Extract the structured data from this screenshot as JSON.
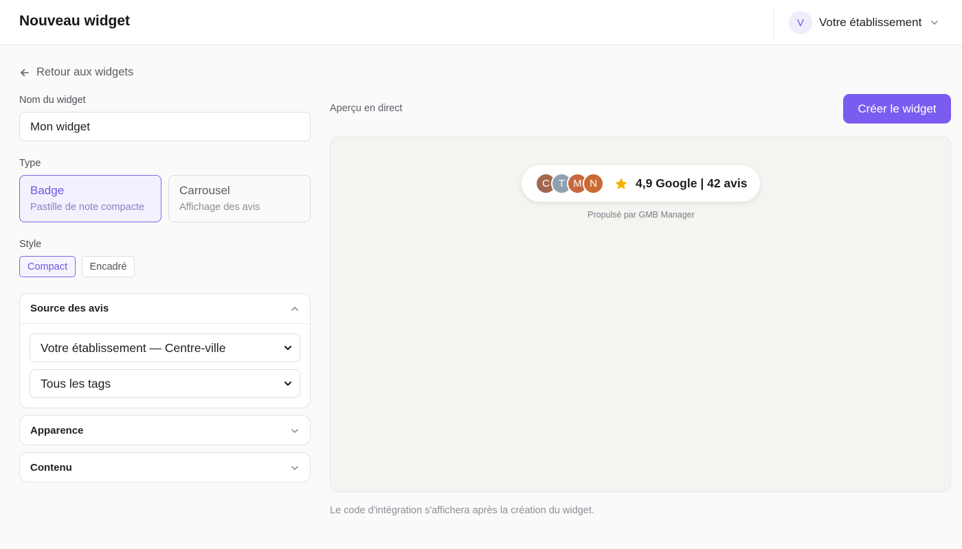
{
  "header": {
    "title": "Nouveau widget",
    "business": {
      "avatar_letter": "V",
      "name": "Votre établissement"
    }
  },
  "back_link": "Retour aux widgets",
  "form": {
    "name": {
      "label": "Nom du widget",
      "value": "Mon widget"
    },
    "type": {
      "label": "Type",
      "options": [
        {
          "title": "Badge",
          "subtitle": "Pastille de note compacte",
          "selected": true
        },
        {
          "title": "Carrousel",
          "subtitle": "Affichage des avis",
          "selected": false
        }
      ]
    },
    "style": {
      "label": "Style",
      "options": [
        {
          "label": "Compact",
          "selected": true
        },
        {
          "label": "Encadré",
          "selected": false
        }
      ]
    },
    "sections": {
      "source": {
        "title": "Source des avis",
        "expanded": true,
        "location_select": "Votre établissement — Centre-ville",
        "tags_select": "Tous les tags"
      },
      "appearance": {
        "title": "Apparence",
        "expanded": false
      },
      "content": {
        "title": "Contenu",
        "expanded": false
      }
    }
  },
  "preview": {
    "label": "Aperçu en direct",
    "create_button": "Créer le widget",
    "badge": {
      "avatars": [
        {
          "letter": "C",
          "color": "#a0694f"
        },
        {
          "letter": "T",
          "color": "#8fa1b0"
        },
        {
          "letter": "M",
          "color": "#c8683f"
        },
        {
          "letter": "N",
          "color": "#c96a35"
        }
      ],
      "rating_text": "4,9 Google | 42 avis",
      "star_color": "#f5b400"
    },
    "powered_by": "Propulsé par GMB Manager",
    "embed_note": "Le code d'intégration s'affichera après la création du widget."
  },
  "colors": {
    "accent": "#7b5cf0"
  }
}
